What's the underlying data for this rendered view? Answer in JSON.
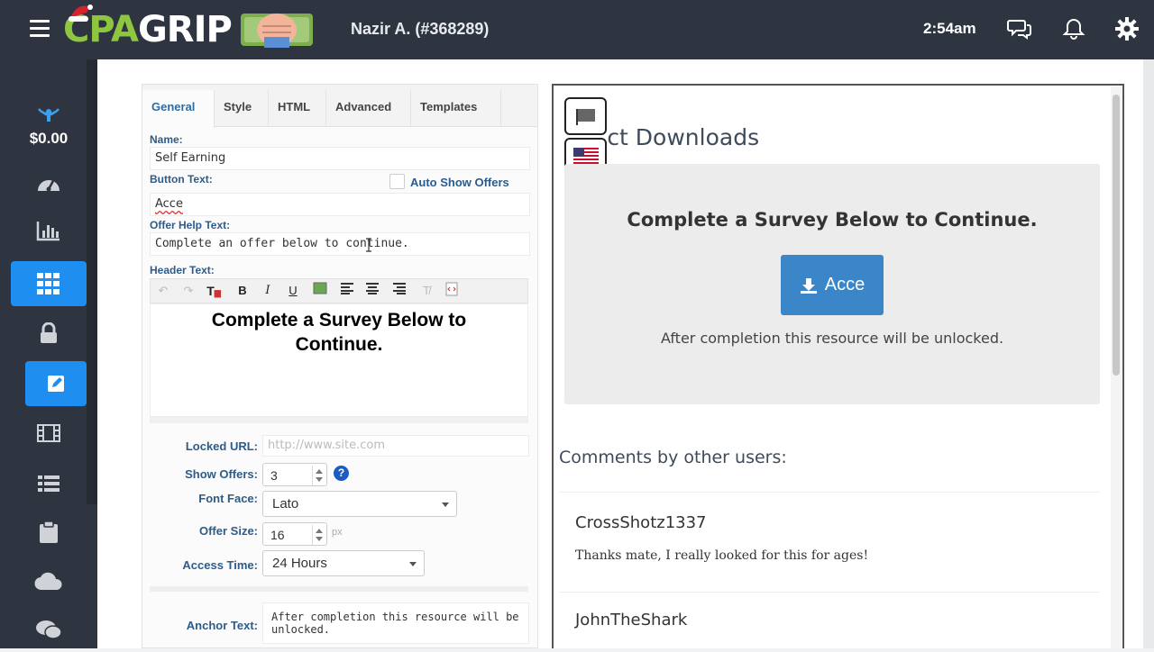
{
  "header": {
    "logo_text_cpa": "CPA",
    "logo_text_grip": "GRIP",
    "user": "Nazir A. (#368289)",
    "time": "2:54am"
  },
  "sidebar": {
    "balance": "$0.00",
    "items": [
      {
        "icon": "dashboard-icon"
      },
      {
        "icon": "bar-chart-icon"
      },
      {
        "icon": "grid-icon",
        "active": true
      },
      {
        "icon": "lock-icon"
      },
      {
        "icon": "edit-icon",
        "active": true
      },
      {
        "icon": "film-icon"
      },
      {
        "icon": "list-icon"
      },
      {
        "icon": "clipboard-icon"
      },
      {
        "icon": "cloud-icon"
      },
      {
        "icon": "chat-icon"
      }
    ]
  },
  "editor": {
    "tabs": [
      "General",
      "Style",
      "HTML",
      "Advanced",
      "Templates"
    ],
    "name_label": "Name:",
    "name_value": "Self Earning",
    "button_text_label": "Button Text:",
    "auto_show_label": "Auto Show Offers",
    "button_text_value": "Acce",
    "offer_help_label": "Offer Help Text:",
    "offer_help_value": "Complete an offer below to continue.",
    "header_text_label": "Header Text:",
    "header_text_line1": "Complete a Survey Below to",
    "header_text_line2": "Continue.",
    "locked_url_label": "Locked URL:",
    "locked_url_placeholder": "http://www.site.com",
    "show_offers_label": "Show Offers:",
    "show_offers_value": "3",
    "font_face_label": "Font Face:",
    "font_face_value": "Lato",
    "offer_size_label": "Offer Size:",
    "offer_size_value": "16",
    "offer_size_unit": "px",
    "access_time_label": "Access Time:",
    "access_time_value": "24 Hours",
    "anchor_text_label": "Anchor Text:",
    "anchor_text_value": "After completion this resource will be unlocked."
  },
  "preview": {
    "title": "Direct Downloads",
    "title_visible": "ct Downloads",
    "heading": "Complete a Survey Below to Continue.",
    "button_label": "Acce",
    "subtext": "After completion this resource will be unlocked.",
    "comments_heading": "Comments by other users:",
    "comments": [
      {
        "author": "CrossShotz1337",
        "text": "Thanks mate, I really looked for this for ages!"
      },
      {
        "author": "JohnTheShark",
        "text": ""
      }
    ]
  },
  "colors": {
    "topbar": "#2e3540",
    "accent": "#1f8ef1",
    "locker_button": "#3a86c8",
    "label_blue": "#2d5b8a"
  }
}
